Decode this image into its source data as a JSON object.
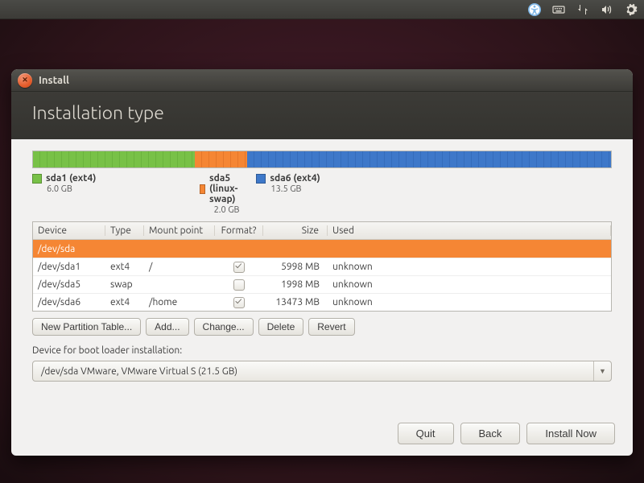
{
  "menubar": {
    "indicators": [
      "accessibility",
      "keyboard",
      "network",
      "volume",
      "settings-gear"
    ]
  },
  "window": {
    "close_tooltip": "Close",
    "title": "Install",
    "heading": "Installation type"
  },
  "partitions": {
    "segments": [
      {
        "id": "sda1",
        "label": "sda1 (ext4)",
        "size_label": "6.0 GB",
        "color": "green",
        "pct": 28
      },
      {
        "id": "sda5",
        "label": "sda5 (linux-swap)",
        "size_label": "2.0 GB",
        "color": "orange",
        "pct": 9
      },
      {
        "id": "sda6",
        "label": "sda6 (ext4)",
        "size_label": "13.5 GB",
        "color": "blue",
        "pct": 63
      }
    ]
  },
  "table": {
    "headers": {
      "device": "Device",
      "type": "Type",
      "mount": "Mount point",
      "format": "Format?",
      "size": "Size",
      "used": "Used"
    },
    "disk_row": "/dev/sda",
    "rows": [
      {
        "device": "/dev/sda1",
        "type": "ext4",
        "mount": "/",
        "format": true,
        "size": "5998 MB",
        "used": "unknown"
      },
      {
        "device": "/dev/sda5",
        "type": "swap",
        "mount": "",
        "format": false,
        "size": "1998 MB",
        "used": "unknown"
      },
      {
        "device": "/dev/sda6",
        "type": "ext4",
        "mount": "/home",
        "format": true,
        "size": "13473 MB",
        "used": "unknown"
      }
    ]
  },
  "part_buttons": {
    "new_table": "New Partition Table...",
    "add": "Add...",
    "change": "Change...",
    "delete": "Delete",
    "revert": "Revert"
  },
  "bootloader": {
    "label": "Device for boot loader installation:",
    "value": "/dev/sda   VMware, VMware Virtual S (21.5 GB)"
  },
  "footer": {
    "quit": "Quit",
    "back": "Back",
    "install": "Install Now"
  }
}
